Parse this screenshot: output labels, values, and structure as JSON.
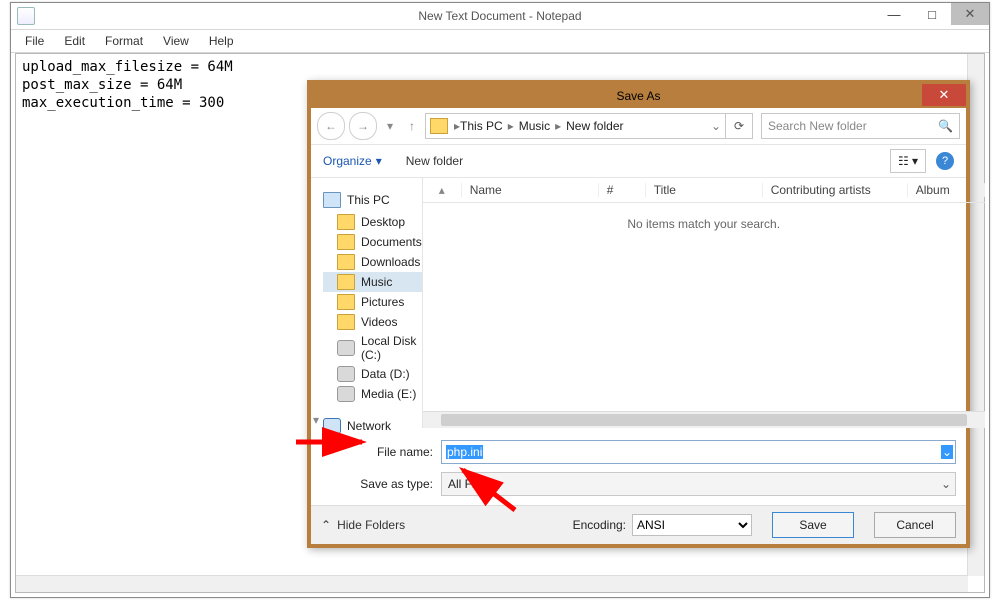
{
  "notepad": {
    "title": "New Text Document - Notepad",
    "menu": [
      "File",
      "Edit",
      "Format",
      "View",
      "Help"
    ],
    "content": "upload_max_filesize = 64M\npost_max_size = 64M\nmax_execution_time = 300"
  },
  "dialog": {
    "title": "Save As",
    "breadcrumbs": [
      "This PC",
      "Music",
      "New folder"
    ],
    "search_placeholder": "Search New folder",
    "toolbar": {
      "organize": "Organize",
      "newfolder": "New folder"
    },
    "columns": {
      "name": "Name",
      "num": "#",
      "title": "Title",
      "artists": "Contributing artists",
      "album": "Album"
    },
    "empty_msg": "No items match your search.",
    "tree": {
      "thispc": "This PC",
      "items": [
        "Desktop",
        "Documents",
        "Downloads",
        "Music",
        "Pictures",
        "Videos",
        "Local Disk (C:)",
        "Data (D:)",
        "Media (E:)"
      ],
      "selected_index": 3,
      "network": "Network"
    },
    "filename_label": "File name:",
    "filename_value": "php.ini",
    "savetype_label": "Save as type:",
    "savetype_value": "All Files",
    "hide_folders": "Hide Folders",
    "encoding_label": "Encoding:",
    "encoding_value": "ANSI",
    "save_btn": "Save",
    "cancel_btn": "Cancel"
  }
}
